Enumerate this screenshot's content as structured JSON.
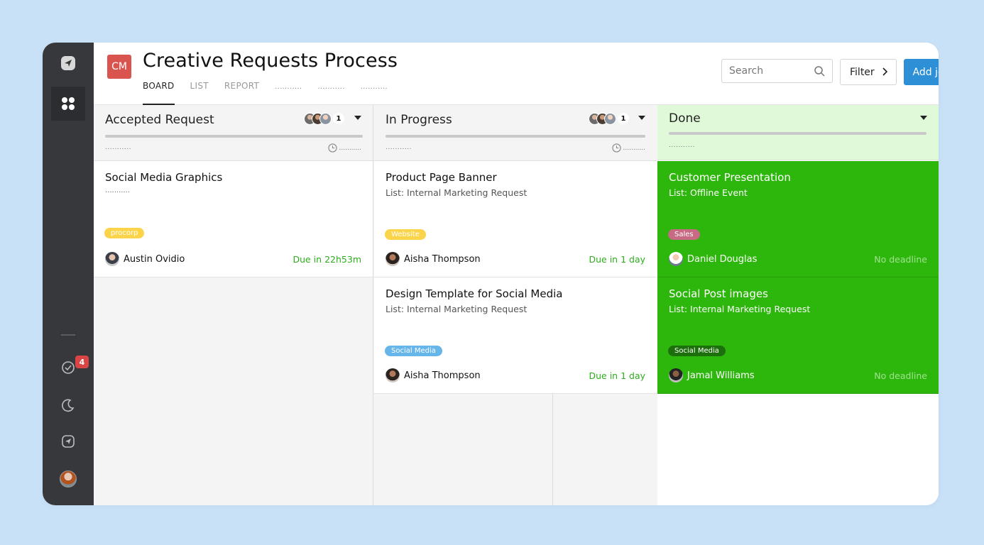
{
  "app": {
    "logo_text": "CM",
    "title": "Creative Requests Process"
  },
  "tabs": [
    {
      "label": "BOARD",
      "active": true
    },
    {
      "label": "LIST",
      "active": false
    },
    {
      "label": "REPORT",
      "active": false
    },
    {
      "label": "...........",
      "active": false
    },
    {
      "label": "...........",
      "active": false
    },
    {
      "label": "...........",
      "active": false
    }
  ],
  "toolbar": {
    "search_placeholder": "Search",
    "filter_label": "Filter",
    "add_label": "Add job"
  },
  "sidebar": {
    "icons": [
      "send-icon",
      "apps-grid-icon",
      "check-circle-icon",
      "moon-icon",
      "send-square-icon"
    ],
    "badge_count": "4"
  },
  "colors": {
    "accent": "#2d8fd6",
    "done_green": "#2db60c",
    "done_header": "#dff9d9",
    "due_green": "#2cae1b",
    "logo_red": "#d9534f"
  },
  "columns": [
    {
      "title": "Accepted Request",
      "avatar_count": "1",
      "dots": "...........",
      "time_dots": "...........",
      "cards": [
        {
          "title": "Social Media Graphics",
          "subtitle_dots": "...........",
          "tag": "procorp",
          "assignee": "Austin Ovidio",
          "due": "Due in 22h53m"
        }
      ]
    },
    {
      "title": "In Progress",
      "avatar_count": "1",
      "dots": "...........",
      "time_dots": "...........",
      "cards": [
        {
          "title": "Product Page Banner",
          "subtitle": "List: Internal Marketing Request",
          "tag": "Website",
          "assignee": "Aisha Thompson",
          "due": "Due in 1 day"
        },
        {
          "title": "Design Template for Social Media",
          "subtitle": "List: Internal Marketing Request",
          "tag": "Social Media",
          "assignee": "Aisha Thompson",
          "due": "Due in 1 day"
        }
      ]
    },
    {
      "title": "Done",
      "dots": "...........",
      "cards": [
        {
          "title": "Customer Presentation",
          "subtitle": "List: Offline Event",
          "tag": "Sales",
          "assignee": "Daniel Douglas",
          "due": "No deadline"
        },
        {
          "title": "Social Post images",
          "subtitle": "List: Internal Marketing Request",
          "tag": "Social Media",
          "assignee": "Jamal Williams",
          "due": "No deadline"
        }
      ]
    }
  ]
}
